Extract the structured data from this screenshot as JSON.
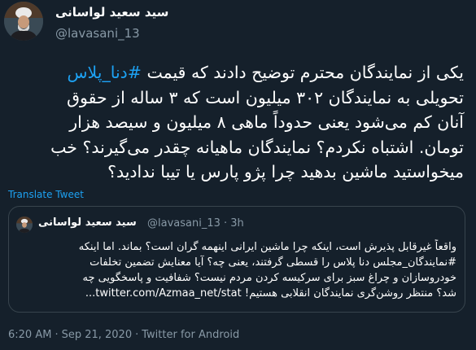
{
  "tweet": {
    "author_name": "سید سعید لواسانی",
    "author_handle": "@lavasani_13",
    "body": {
      "line1_prefix": "یکی از نمایندگان محترم توضیح دادند که قیمت ",
      "line1_hashtag": "#دنا_پلاس",
      "line2": "تحویلی به نمایندگان ۳۰۲ میلیون است که ۳ ساله از حقوق",
      "line3": "آنان کم می‌شود یعنی حدوداً ماهی ۸ میلیون و سیصد هزار",
      "line4": "تومان. اشتباه نکردم؟ نمایندگان ماهیانه چقدر می‌گیرند؟ خب",
      "line5": "میخواستید ماشین بدهید چرا پژو پارس یا تیبا ندادید؟"
    },
    "translate_label": "Translate Tweet",
    "quoted": {
      "author_name": "سید سعید لواسانی",
      "handle_and_time": "@lavasani_13 · 3h",
      "lines": [
        "واقعاً غیرقابل پذیرش است، اینکه چرا ماشین ایرانی اینهمه گران است؟ بماند. اما اینکه",
        "#نمایندگان_مجلس دنا پلاس را قسطی گرفتند، یعنی چه؟ آیا معنایش تضمین تخلفات",
        "خودروسازان و چراغ سبز برای سرکیسه کردن مردم نیست؟ شفافیت و پاسخگویی چه",
        "شد؟ منتظر روشن‌گری نمایندگان انقلابی هستیم! twitter.com/Azmaa_net/stat..."
      ]
    },
    "time": "6:20 AM",
    "separator": "·",
    "date": "Sep 21, 2020",
    "source": "Twitter for Android"
  }
}
